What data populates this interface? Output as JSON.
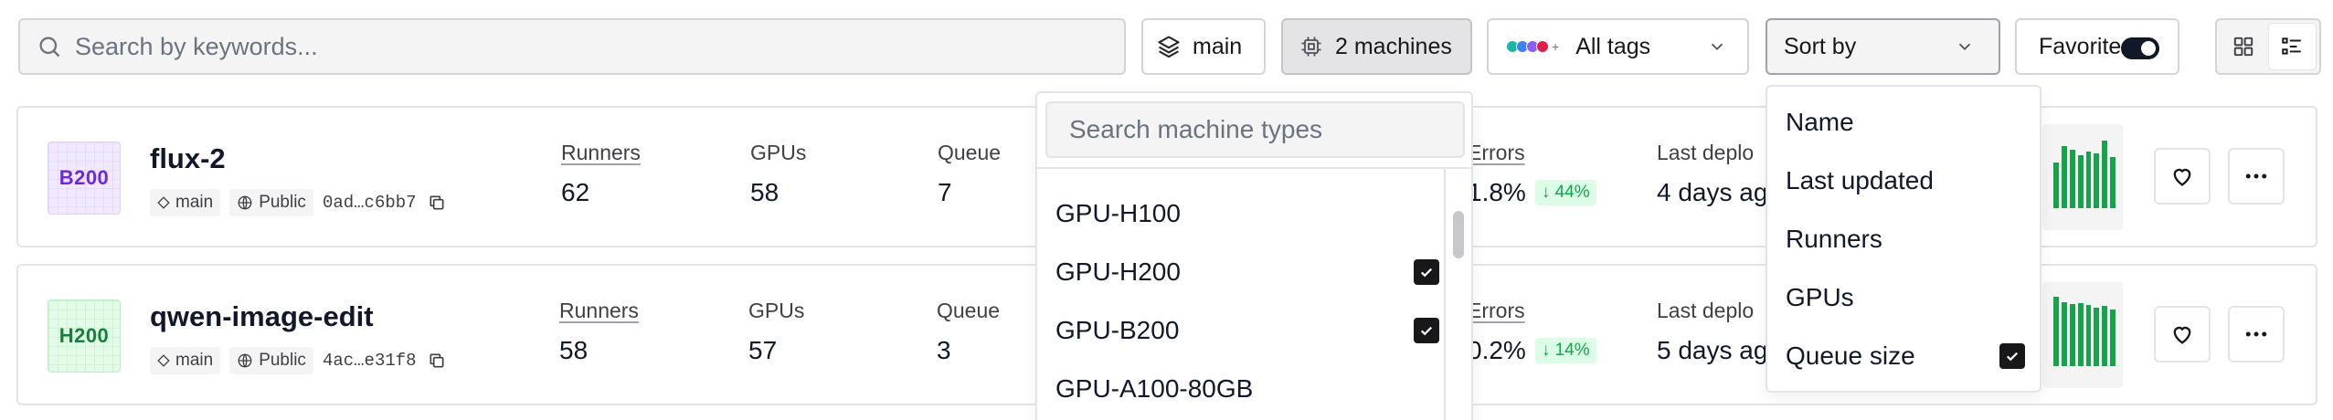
{
  "toolbar": {
    "search_placeholder": "Search by keywords...",
    "branch_label": "main",
    "machines_label": "2 machines",
    "tags_label": "All tags",
    "tag_dot_colors": [
      "#14b8a6",
      "#3b82f6",
      "#8b5cf6",
      "#e11d48"
    ],
    "tags_plus": "+",
    "sort_label": "Sort by",
    "favorites_label": "Favorites",
    "favorites_on": true,
    "view_mode": "list"
  },
  "machines_dropdown": {
    "search_placeholder": "Search machine types",
    "items": [
      {
        "label": "GPU-H100",
        "checked": false
      },
      {
        "label": "GPU-H200",
        "checked": true
      },
      {
        "label": "GPU-B200",
        "checked": true
      },
      {
        "label": "GPU-A100-80GB",
        "checked": false
      }
    ]
  },
  "sort_dropdown": {
    "items": [
      {
        "label": "Name",
        "checked": false
      },
      {
        "label": "Last updated",
        "checked": false
      },
      {
        "label": "Runners",
        "checked": false
      },
      {
        "label": "GPUs",
        "checked": false
      },
      {
        "label": "Queue size",
        "checked": true
      }
    ]
  },
  "apps": [
    {
      "gpu": "B200",
      "name": "flux-2",
      "branch": "main",
      "visibility": "Public",
      "hash": "0ad…c6bb7",
      "runners_label": "Runners",
      "runners": "62",
      "gpus_label": "GPUs",
      "gpus": "58",
      "queue_label": "Queue",
      "queue": "7",
      "errors_label": "Errors",
      "errors": "1.8%",
      "errors_delta": "↓ 44%",
      "deploy_label": "Last deplo",
      "deploy": "4 days ag",
      "spark": [
        0.62,
        0.85,
        0.8,
        0.72,
        0.78,
        0.75,
        0.92,
        0.7
      ]
    },
    {
      "gpu": "H200",
      "name": "qwen-image-edit",
      "branch": "main",
      "visibility": "Public",
      "hash": "4ac…e31f8",
      "runners_label": "Runners",
      "runners": "58",
      "gpus_label": "GPUs",
      "gpus": "57",
      "queue_label": "Queue",
      "queue": "3",
      "errors_label": "Errors",
      "errors": "0.2%",
      "errors_delta": "↓ 14%",
      "deploy_label": "Last deplo",
      "deploy": "5 days ago",
      "spark": [
        0.95,
        0.88,
        0.85,
        0.86,
        0.84,
        0.8,
        0.82,
        0.78
      ]
    }
  ]
}
